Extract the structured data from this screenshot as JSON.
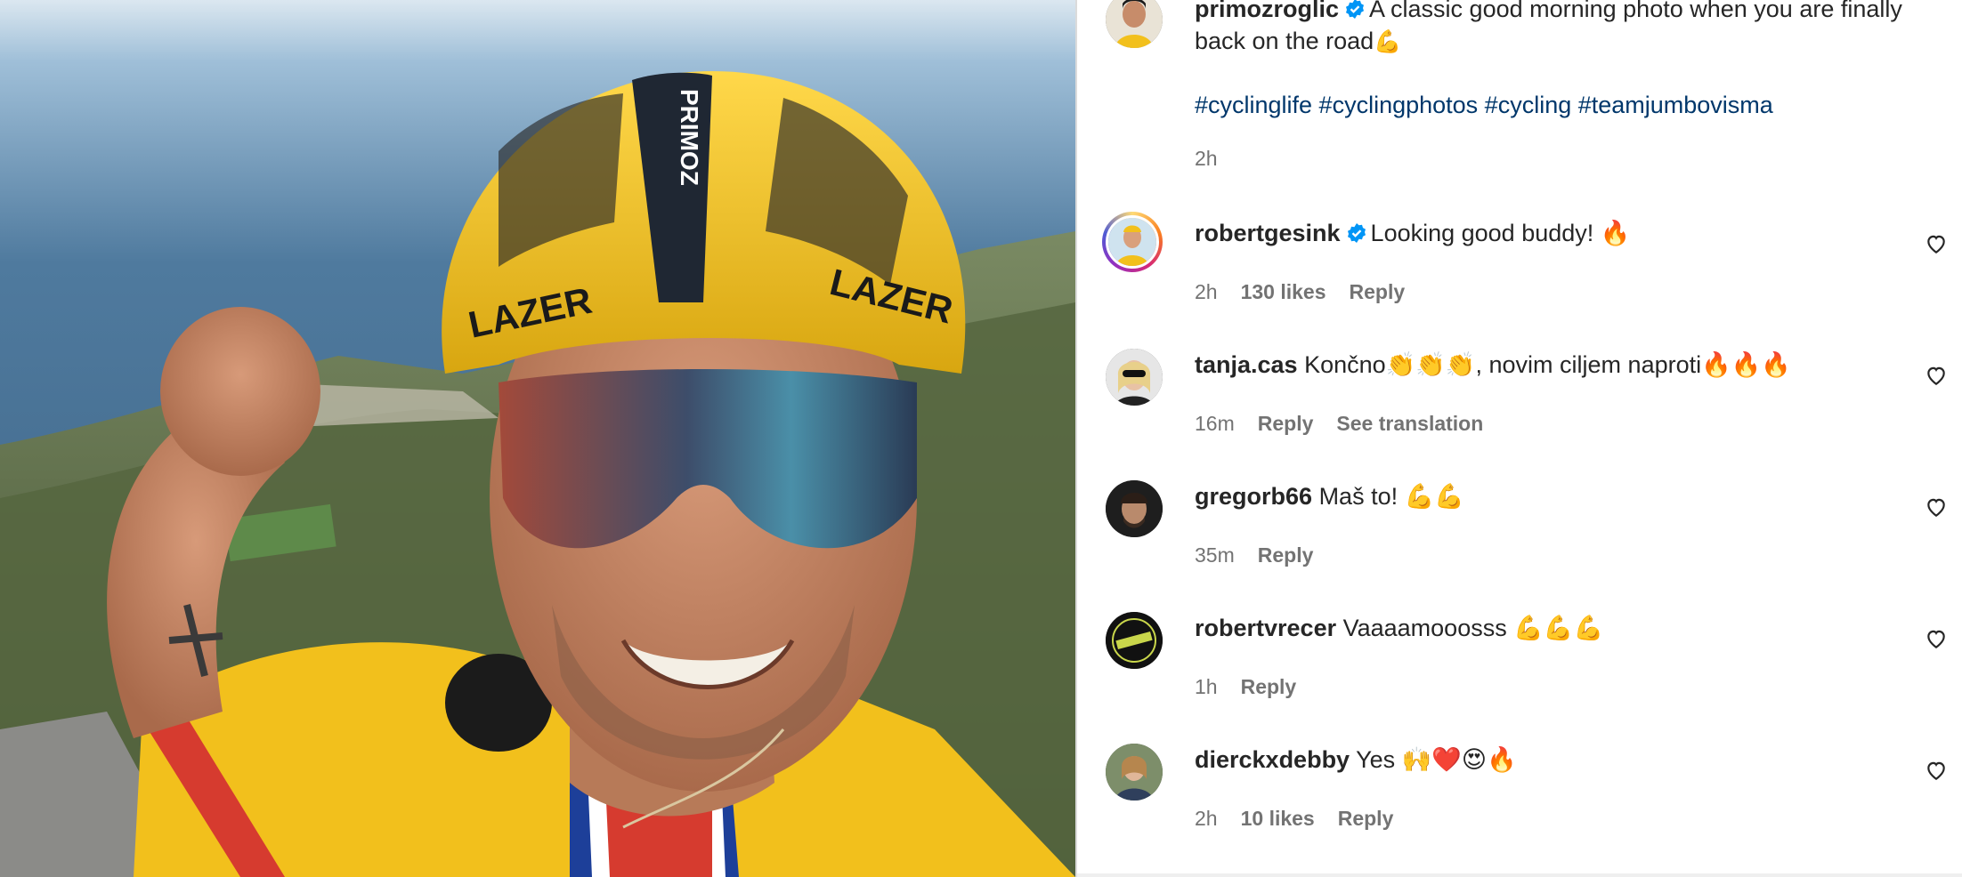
{
  "post": {
    "author": "primozroglic",
    "caption": "A classic good morning photo when you are finally back on the road",
    "caption_emoji": "💪",
    "hashtags": "#cyclinglife #cyclingphotos #cycling #teamjumbovisma",
    "time": "2h"
  },
  "comments": [
    {
      "user": "robertgesink",
      "verified": true,
      "text": "Looking good buddy! 🔥",
      "time": "2h",
      "likes": "130 likes",
      "reply": "Reply",
      "extra": ""
    },
    {
      "user": "tanja.cas",
      "verified": false,
      "text": "Končno👏👏👏, novim ciljem naproti🔥🔥🔥",
      "time": "16m",
      "likes": "",
      "reply": "Reply",
      "extra": "See translation"
    },
    {
      "user": "gregorb66",
      "verified": false,
      "text": "Maš to! 💪💪",
      "time": "35m",
      "likes": "",
      "reply": "Reply",
      "extra": ""
    },
    {
      "user": "robertvrecer",
      "verified": false,
      "text": "Vaaaamooosss 💪💪💪",
      "time": "1h",
      "likes": "",
      "reply": "Reply",
      "extra": ""
    },
    {
      "user": "dierckxdebby",
      "verified": false,
      "text": "Yes 🙌❤️😍🔥",
      "time": "2h",
      "likes": "10 likes",
      "reply": "Reply",
      "extra": ""
    }
  ],
  "photo_text": {
    "helmet_brand_left": "LAZER",
    "helmet_brand_right": "LAZER",
    "helmet_top": "PRIMOZ"
  },
  "colors": {
    "verified": "#0095f6",
    "hashtag": "#00376b",
    "jersey": "#f2c01c"
  },
  "icons": {
    "like": "heart-icon",
    "verified": "verified-badge-icon"
  }
}
